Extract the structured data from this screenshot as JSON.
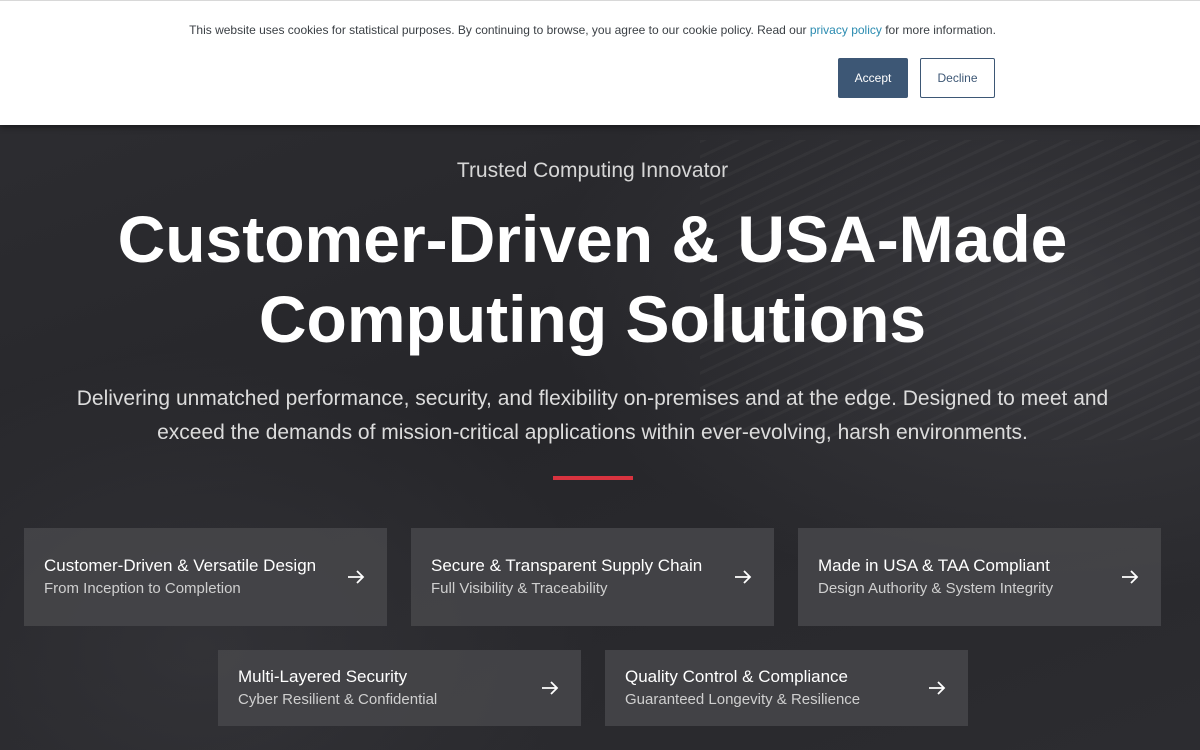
{
  "cookie_banner": {
    "text_before": "This website uses cookies for statistical purposes. By continuing to browse, you agree to our cookie policy. Read our ",
    "link_text": "privacy policy",
    "text_after": " for more information.",
    "accept_label": "Accept",
    "decline_label": "Decline"
  },
  "hero": {
    "eyebrow": "Trusted Computing Innovator",
    "headline_line1": "Customer-Driven & USA-Made",
    "headline_line2": "Computing Solutions",
    "subtext": "Delivering unmatched performance, security, and flexibility on-premises and at the edge. Designed to meet and exceed the demands of mission-critical applications within ever-evolving, harsh environments."
  },
  "features": [
    {
      "title": "Customer-Driven & Versatile Design",
      "subtitle": "From Inception to Completion",
      "icon": "arrow-right-icon"
    },
    {
      "title": "Secure & Transparent Supply Chain",
      "subtitle": "Full Visibility & Traceability",
      "icon": "arrow-right-icon"
    },
    {
      "title": "Made in USA & TAA Compliant",
      "subtitle": "Design Authority & System Integrity",
      "icon": "arrow-right-icon"
    },
    {
      "title": "Multi-Layered Security",
      "subtitle": "Cyber Resilient & Confidential",
      "icon": "arrow-right-icon"
    },
    {
      "title": "Quality Control & Compliance",
      "subtitle": "Guaranteed Longevity & Resilience",
      "icon": "arrow-right-icon"
    }
  ],
  "colors": {
    "accent_red": "#d8333f",
    "button_blue": "#3d5775",
    "link_blue": "#2a8bb0",
    "card_bg": "#48484c"
  }
}
